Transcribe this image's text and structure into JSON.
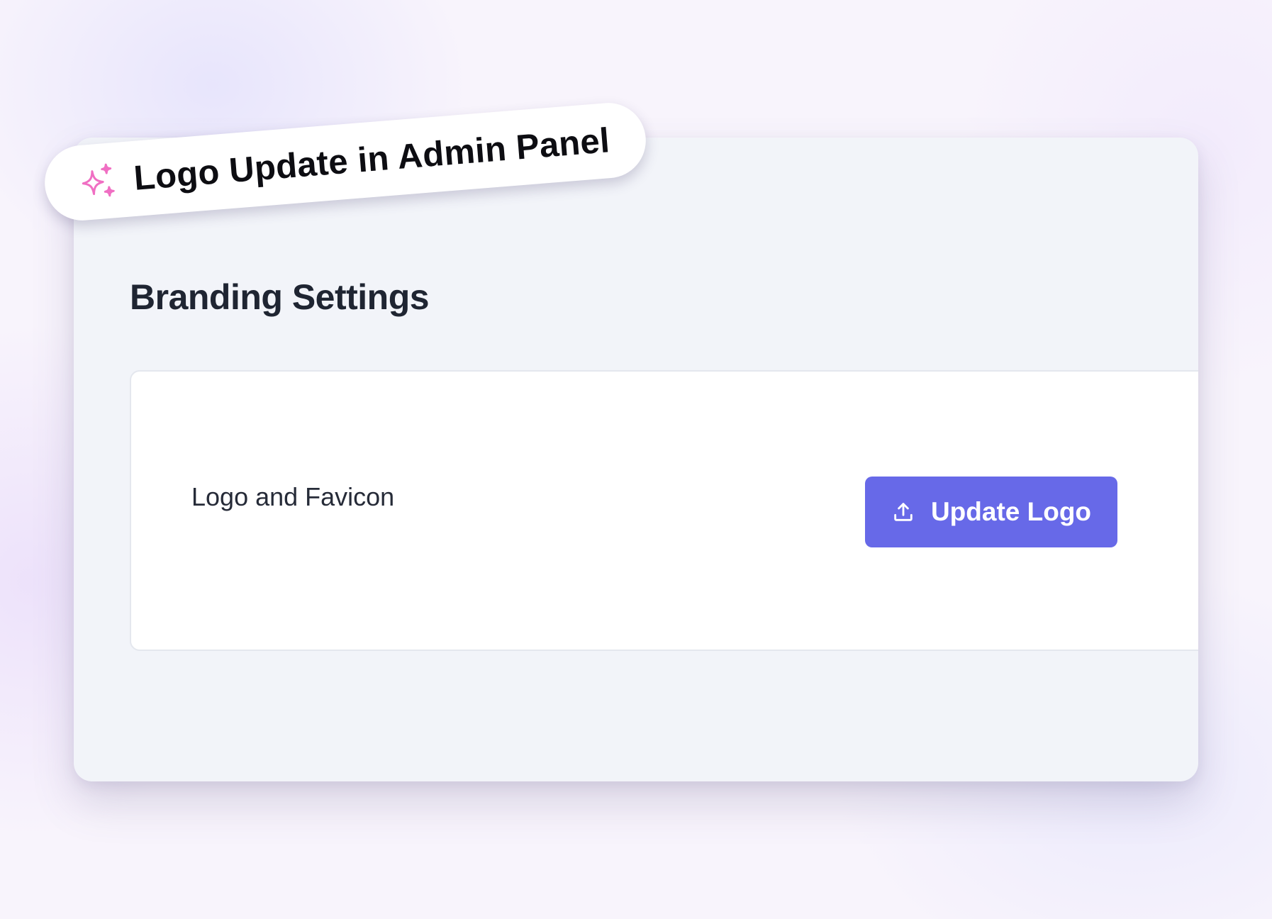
{
  "callout": {
    "text": "Logo Update in Admin Panel",
    "icon": "sparkles-icon",
    "icon_color": "#f06fc3"
  },
  "page": {
    "title": "Branding Settings"
  },
  "branding": {
    "row_label": "Logo and Favicon",
    "button_label": "Update Logo",
    "button_icon": "upload-icon",
    "button_color": "#6769e8"
  }
}
